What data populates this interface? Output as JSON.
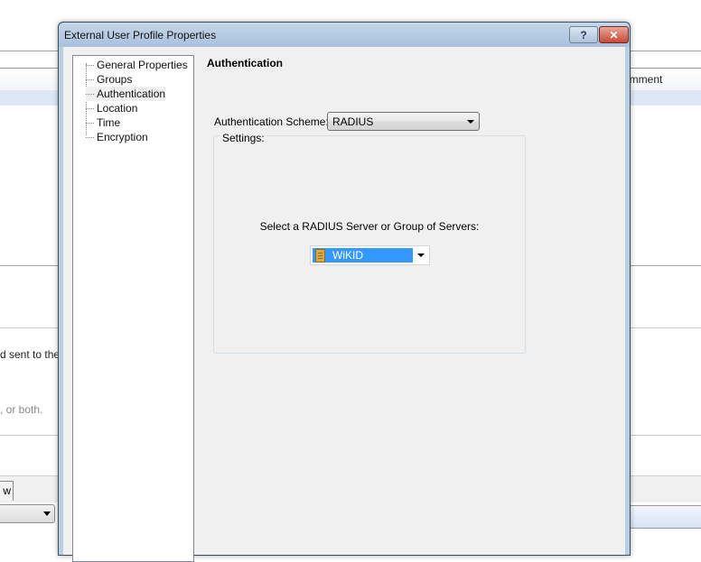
{
  "background_window": {
    "column_header_comment": "omment",
    "text_line_1": "d sent to their",
    "text_line_2": ", or both.",
    "tab_label": "w"
  },
  "dialog": {
    "title": "External User Profile Properties",
    "help_button_label": "?",
    "close_button_label": "✕",
    "tree": {
      "items": [
        {
          "label": "General Properties",
          "selected": false
        },
        {
          "label": "Groups",
          "selected": false
        },
        {
          "label": "Authentication",
          "selected": true
        },
        {
          "label": "Location",
          "selected": false
        },
        {
          "label": "Time",
          "selected": false
        },
        {
          "label": "Encryption",
          "selected": false
        }
      ]
    },
    "pane": {
      "title": "Authentication",
      "scheme_label": "Authentication Scheme:",
      "scheme_value": "RADIUS",
      "settings_legend": "Settings:",
      "server_prompt": "Select a RADIUS Server or Group of Servers:",
      "server_value": "WiKID",
      "server_icon": "server-icon",
      "selection_color": "#3399ff"
    }
  }
}
